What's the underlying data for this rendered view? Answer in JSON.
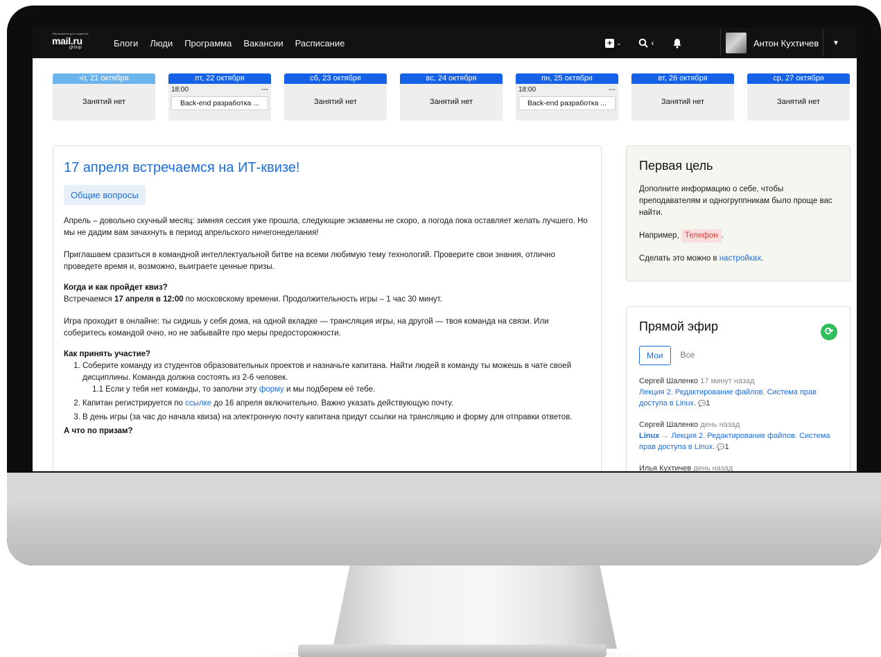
{
  "logo": {
    "small_text": "Образование для студентов",
    "main": "mail.ru",
    "sub": "group"
  },
  "nav": {
    "links": [
      "Блоги",
      "Люди",
      "Программа",
      "Вакансии",
      "Расписание"
    ]
  },
  "user": {
    "name": "Антон Кухтичев"
  },
  "schedule": [
    {
      "date": "чт, 21 октября",
      "empty": "Занятий нет"
    },
    {
      "date": "пт, 22 октября",
      "time": "18:00",
      "extra": "---",
      "event": "Back-end разработка ..."
    },
    {
      "date": "сб, 23 октября",
      "empty": "Занятий нет"
    },
    {
      "date": "вс, 24 октября",
      "empty": "Занятий нет"
    },
    {
      "date": "пн, 25 октября",
      "time": "18:00",
      "extra": "---",
      "event": "Back-end разработка ..."
    },
    {
      "date": "вт, 26 октября",
      "empty": "Занятий нет"
    },
    {
      "date": "ср, 27 октября",
      "empty": "Занятий нет"
    }
  ],
  "post": {
    "title": "17 апреля встречаемся на ИТ-квизе!",
    "tag": "Общие вопросы",
    "p1": "Апрель – довольно скучный месяц: зимняя сессия уже прошла, следующие экзамены не скоро, а погода пока оставляет желать лучшего. Но мы не дадим вам зачахнуть в период апрельского ничегонеделания!",
    "p2": "Приглашаем сразиться в командной интеллектуальной битве на всеми любимую тему технологий. Проверите свои знания, отлично проведете время и, возможно, выиграете ценные призы.",
    "when_heading": "Когда и как пройдет квиз?",
    "when_pre": "Встречаемся ",
    "when_bold": "17 апреля в 12:00",
    "when_post": " по московскому времени. Продолжительность игры – 1 час 30 минут.",
    "p3": "Игра проходит в онлайне: ты сидишь у себя дома, на одной вкладке — трансляция игры, на другой — твоя команда на связи. Или соберитесь командой очно, но не забывайте про меры предосторожности.",
    "how_heading": "Как принять участие?",
    "step1": "Соберите команду из студентов образовательных проектов и назначьте капитана. Найти людей в команду ты можешь в чате своей дисциплины. Команда должна состоять из 2-6 человек.",
    "step1_sub_pre": "1.1 Если у тебя нет команды, то заполни эту ",
    "step1_sub_link": "форму",
    "step1_sub_post": " и мы подберем её тебе.",
    "step2_pre": "Капитан регистрируется по ",
    "step2_link": "ссылке",
    "step2_post": " до 16 апреля включительно. Важно указать действующую почту.",
    "step3": "В день игры (за час до начала квиза) на электронную почту капитана придут ссылки на трансляцию и форму для отправки ответов.",
    "prizes_heading": "А что по призам?"
  },
  "goal": {
    "title": "Первая цель",
    "text": "Дополните информацию о себе, чтобы преподавателям и одногруппникам было проще вас найти.",
    "example_pre": "Например, ",
    "example_chip": "Телефон",
    "example_post": ".",
    "settings_pre": "Сделать это можно в ",
    "settings_link": "настройках",
    "settings_post": "."
  },
  "live": {
    "title": "Прямой эфир",
    "tabs": [
      "Мои",
      "Все"
    ],
    "items": [
      {
        "author": "Сергей Шаленко",
        "time": "17 минут назад",
        "prefix": "",
        "link": "Лекция 2. Редактирование файлов. Система прав доступа в Linux.",
        "comments": "1"
      },
      {
        "author": "Сергей Шаленко",
        "time": "день назад",
        "prefix": "Linux",
        "arrow": "→",
        "link": "Лекция 2. Редактирование файлов. Система прав доступа в Linux.",
        "comments": "1"
      },
      {
        "author": "Илья Кухтичев",
        "time": "день назад",
        "prefix": "",
        "link": "",
        "comments": ""
      }
    ]
  }
}
